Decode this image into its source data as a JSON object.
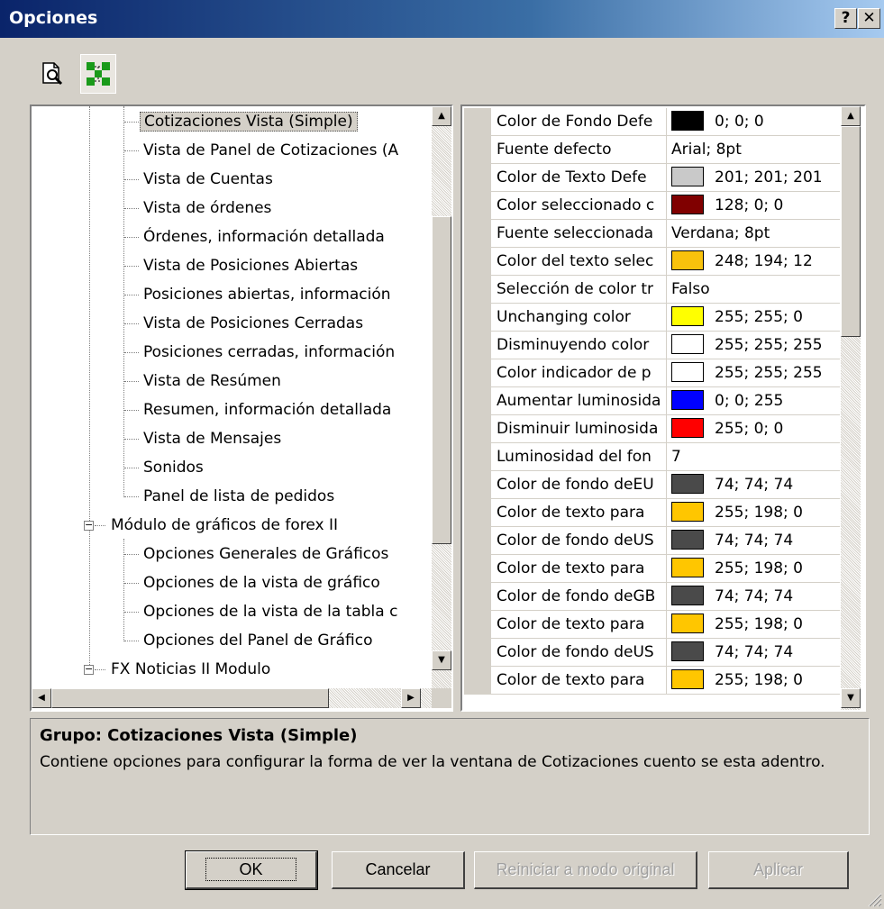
{
  "window": {
    "title": "Opciones",
    "help_label": "?",
    "close_label": "✕"
  },
  "toolbar": {
    "buttons": [
      {
        "icon": "preview-icon"
      },
      {
        "icon": "tree-view-icon",
        "active": true
      }
    ]
  },
  "tree": {
    "items": [
      {
        "label": "Cotizaciones Vista (Simple)",
        "selected": true
      },
      {
        "label": "Vista de Panel de Cotizaciones (A"
      },
      {
        "label": "Vista de Cuentas"
      },
      {
        "label": "Vista de órdenes"
      },
      {
        "label": "Órdenes, información detallada"
      },
      {
        "label": "Vista de Posiciones Abiertas"
      },
      {
        "label": "Posiciones abiertas, información"
      },
      {
        "label": "Vista de Posiciones Cerradas"
      },
      {
        "label": "Posiciones cerradas, información"
      },
      {
        "label": "Vista de Resúmen"
      },
      {
        "label": "Resumen, información detallada"
      },
      {
        "label": "Vista de Mensajes"
      },
      {
        "label": "Sonidos"
      },
      {
        "label": "Panel de lista de pedidos"
      },
      {
        "label": "Módulo de gráficos de forex II",
        "group": true,
        "expander": "−"
      },
      {
        "label": "Opciones Generales de Gráficos"
      },
      {
        "label": "Opciones de la vista de gráfico"
      },
      {
        "label": "Opciones de la vista de la tabla c"
      },
      {
        "label": "Opciones del Panel de Gráfico"
      },
      {
        "label": "FX Noticias II Modulo",
        "group": true,
        "expander": "−"
      }
    ]
  },
  "properties": {
    "rows": [
      {
        "name": "Color de Fondo Defe",
        "value": "0; 0; 0",
        "color": "#000000"
      },
      {
        "name": "Fuente defecto",
        "value": "Arial; 8pt"
      },
      {
        "name": "Color de Texto Defe",
        "value": "201; 201; 201",
        "color": "#c9c9c9"
      },
      {
        "name": "Color seleccionado c",
        "value": "128; 0; 0",
        "color": "#800000"
      },
      {
        "name": "Fuente seleccionada",
        "value": "Verdana; 8pt"
      },
      {
        "name": "Color del texto selec",
        "value": "248; 194; 12",
        "color": "#f8c20c"
      },
      {
        "name": "Selección de color tr",
        "value": "Falso"
      },
      {
        "name": "Unchanging color",
        "value": "255; 255; 0",
        "color": "#ffff00"
      },
      {
        "name": "Disminuyendo color",
        "value": "255; 255; 255",
        "color": "#ffffff"
      },
      {
        "name": "Color indicador de p",
        "value": "255; 255; 255",
        "color": "#ffffff"
      },
      {
        "name": "Aumentar luminosida",
        "value": "0; 0; 255",
        "color": "#0000ff"
      },
      {
        "name": "Disminuir luminosida",
        "value": "255; 0; 0",
        "color": "#ff0000"
      },
      {
        "name": "Luminosidad del fon",
        "value": "7"
      },
      {
        "name": "Color de fondo deEU",
        "value": "74; 74; 74",
        "color": "#4a4a4a"
      },
      {
        "name": "Color de texto para",
        "value": "255; 198; 0",
        "color": "#ffc600"
      },
      {
        "name": "Color de fondo deUS",
        "value": "74; 74; 74",
        "color": "#4a4a4a"
      },
      {
        "name": "Color de texto para",
        "value": "255; 198; 0",
        "color": "#ffc600"
      },
      {
        "name": "Color de fondo deGB",
        "value": "74; 74; 74",
        "color": "#4a4a4a"
      },
      {
        "name": "Color de texto para",
        "value": "255; 198; 0",
        "color": "#ffc600"
      },
      {
        "name": "Color de fondo deUS",
        "value": "74; 74; 74",
        "color": "#4a4a4a"
      },
      {
        "name": "Color de texto para",
        "value": "255; 198; 0",
        "color": "#ffc600"
      }
    ]
  },
  "description": {
    "title": "Grupo: Cotizaciones Vista (Simple)",
    "body": "Contiene opciones para configurar la forma de ver la ventana de Cotizaciones cuento se esta adentro."
  },
  "buttons": {
    "ok": "OK",
    "cancel": "Cancelar",
    "reset": "Reiniciar a modo original",
    "apply": "Aplicar"
  },
  "colors": {
    "title_start": "#0a246a",
    "face": "#d4d0c8"
  }
}
